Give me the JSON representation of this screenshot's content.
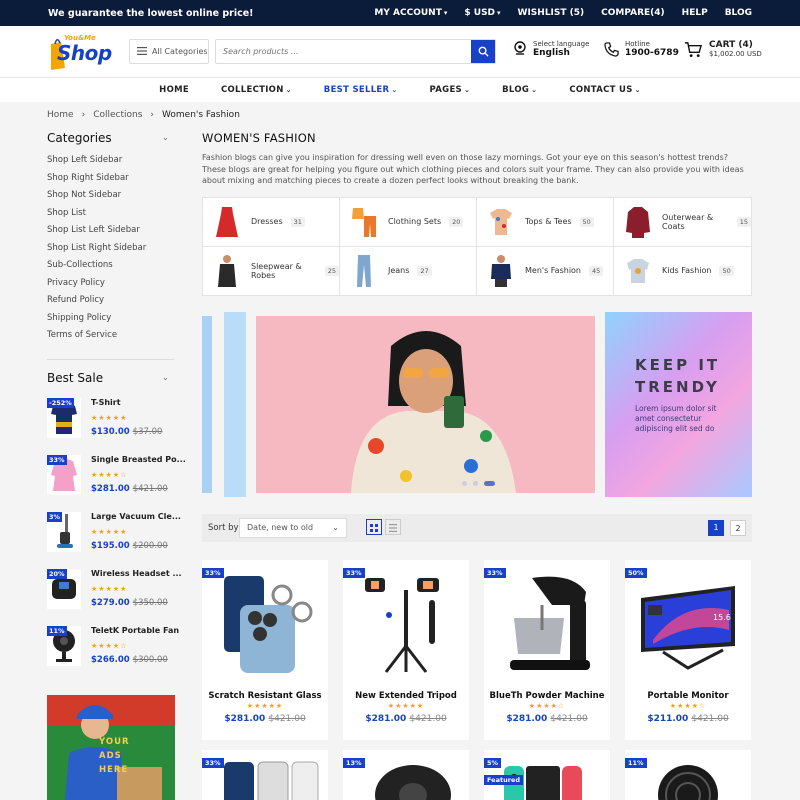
{
  "topbar": {
    "promo": "We guarantee the lowest online price!",
    "links": [
      "MY ACCOUNT",
      "$ USD",
      "WISHLIST (5)",
      "COMPARE(4)",
      "HELP",
      "BLOG"
    ]
  },
  "header": {
    "logo_top": "You&Me",
    "logo_main": "Shop",
    "all_categories": "All Categories",
    "search_placeholder": "Search products ...",
    "language_label": "Select language",
    "language_value": "English",
    "hotline_label": "Hotline",
    "hotline_value": "1900-6789",
    "cart_label": "CART (4)",
    "cart_total": "$1,002.00 USD"
  },
  "nav": {
    "items": [
      "HOME",
      "COLLECTION",
      "BEST SELLER",
      "PAGES",
      "BLOG",
      "CONTACT US"
    ]
  },
  "breadcrumb": [
    "Home",
    "Collections",
    "Women's Fashion"
  ],
  "sidebar": {
    "categories_title": "Categories",
    "categories": [
      "Shop Left Sidebar",
      "Shop Right Sidebar",
      "Shop Not Sidebar",
      "Shop List",
      "Shop List Left Sidebar",
      "Shop List Right Sidebar",
      "Sub-Collections",
      "Privacy Policy",
      "Refund Policy",
      "Shipping Policy",
      "Terms of Service"
    ],
    "best_sale_title": "Best Sale",
    "best_sale": [
      {
        "badge": "-252%",
        "name": "T-Shirt",
        "stars": "★★★★★",
        "price": "$130.00",
        "old": "$37.00"
      },
      {
        "badge": "33%",
        "name": "Single Breasted Po...",
        "stars": "★★★★☆",
        "price": "$281.00",
        "old": "$421.00"
      },
      {
        "badge": "3%",
        "name": "Large Vacuum Cle...",
        "stars": "★★★★★",
        "price": "$195.00",
        "old": "$200.00"
      },
      {
        "badge": "20%",
        "name": "Wireless Headset ...",
        "stars": "★★★★★",
        "price": "$279.00",
        "old": "$350.00"
      },
      {
        "badge": "11%",
        "name": "TeletK Portable Fan",
        "stars": "★★★★☆",
        "price": "$266.00",
        "old": "$300.00"
      }
    ],
    "ad_text": [
      "YOUR",
      "ADS",
      "HERE"
    ]
  },
  "main": {
    "title": "WOMEN'S FASHION",
    "description": "Fashion blogs can give you inspiration for dressing well even on those lazy mornings. Got your eye on this season's hottest trends? These blogs are great for helping you figure out which clothing pieces and colors suit your frame. They can also provide you with ideas about mixing and matching pieces to create a dozen perfect looks without breaking the bank.",
    "categories": [
      {
        "name": "Dresses",
        "count": "31"
      },
      {
        "name": "Clothing Sets",
        "count": "20"
      },
      {
        "name": "Tops & Tees",
        "count": "50"
      },
      {
        "name": "Outerwear & Coats",
        "count": "15"
      },
      {
        "name": "Sleepwear & Robes",
        "count": "25"
      },
      {
        "name": "Jeans",
        "count": "27"
      },
      {
        "name": "Men's Fashion",
        "count": "45"
      },
      {
        "name": "Kids Fashion",
        "count": "50"
      }
    ],
    "banner": {
      "headline_1": "KEEP IT",
      "headline_2": "TRENDY",
      "text": "Lorem ipsum dolor sit amet consectetur adipiscing elit sed do"
    },
    "sort": {
      "label": "Sort by",
      "value": "Date, new to old",
      "pages": [
        "1",
        "2"
      ]
    },
    "products": [
      {
        "badge": "33%",
        "name": "Scratch Resistant Glass",
        "stars": "★★★★★",
        "price": "$281.00",
        "old": "$421.00"
      },
      {
        "badge": "33%",
        "name": "New Extended Tripod",
        "stars": "★★★★★",
        "price": "$281.00",
        "old": "$421.00"
      },
      {
        "badge": "33%",
        "name": "BlueTh Powder Machine",
        "stars": "★★★★☆",
        "price": "$281.00",
        "old": "$421.00"
      },
      {
        "badge": "50%",
        "name": "Portable Monitor",
        "stars": "★★★★☆",
        "price": "$211.00",
        "old": "$421.00"
      }
    ],
    "products_row2": [
      {
        "badge": "33%"
      },
      {
        "badge": "13%"
      },
      {
        "badge": "5%",
        "extra": "Featured"
      },
      {
        "badge": "11%"
      }
    ],
    "monitor_label": "15.6"
  },
  "colors": {
    "primary": "#1741c8",
    "topbar": "#0b1b3a",
    "star": "#f4a500"
  }
}
